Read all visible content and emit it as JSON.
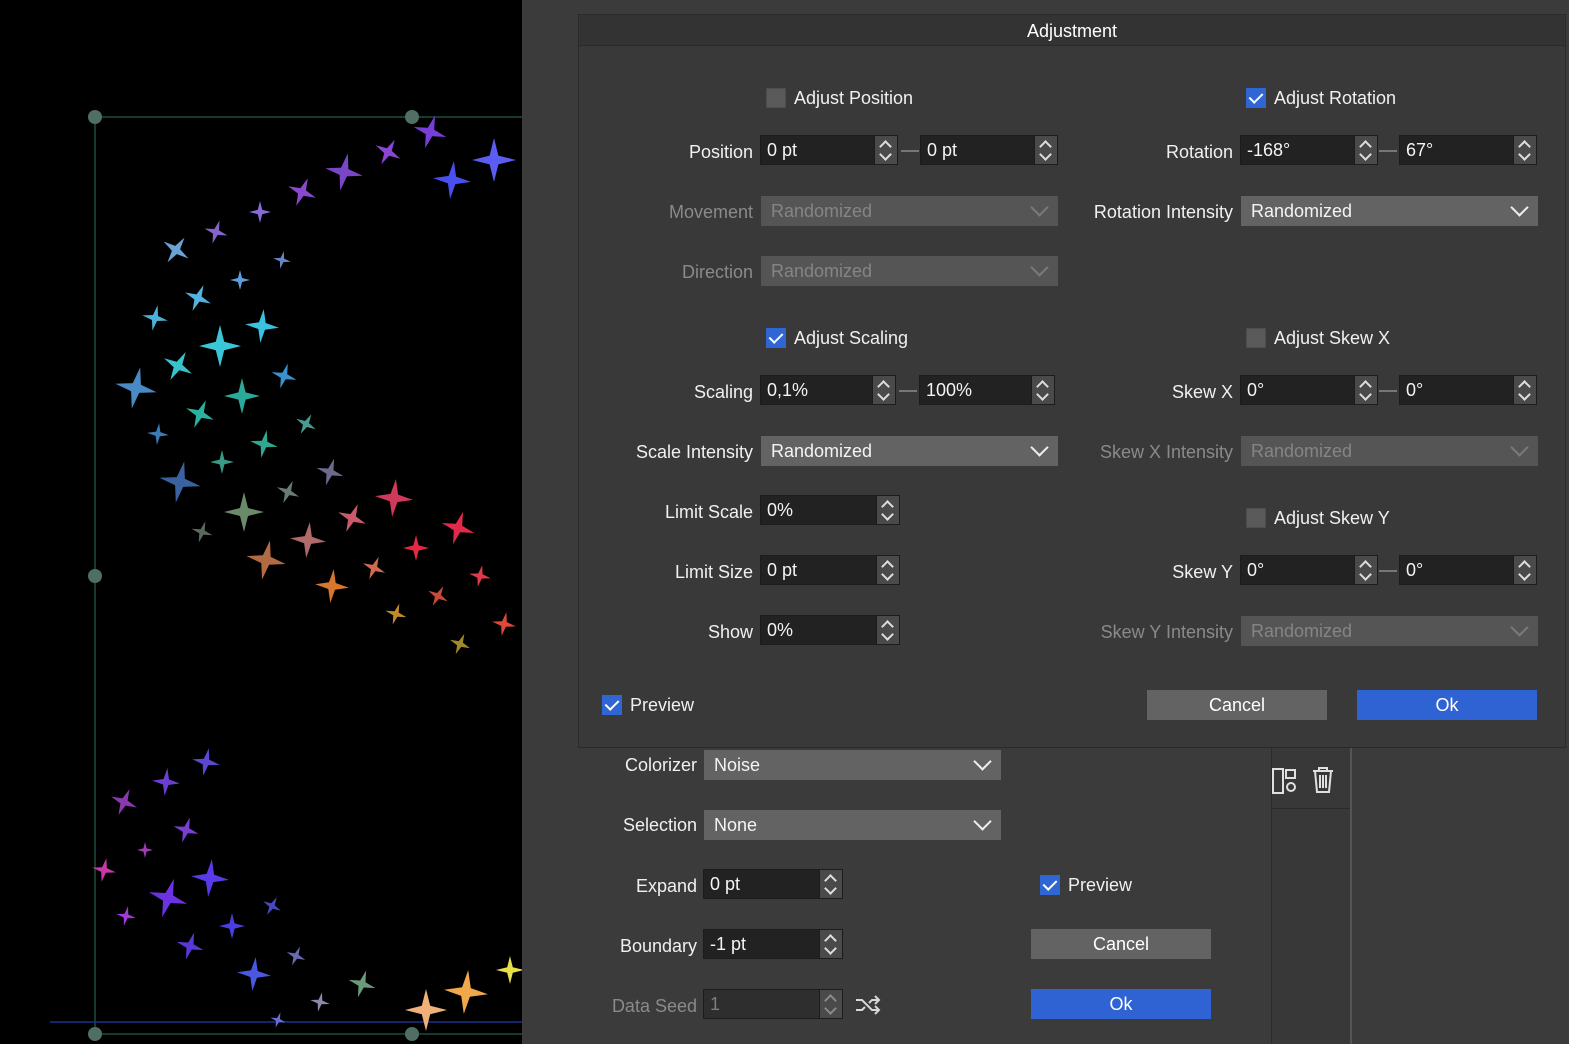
{
  "dialog": {
    "title": "Adjustment",
    "adjust_position": {
      "label": "Adjust Position",
      "checked": false
    },
    "adjust_rotation": {
      "label": "Adjust Rotation",
      "checked": true
    },
    "position": {
      "label": "Position",
      "from": "0 pt",
      "to": "0 pt"
    },
    "rotation": {
      "label": "Rotation",
      "from": "-168°",
      "to": "67°"
    },
    "movement": {
      "label": "Movement",
      "value": "Randomized"
    },
    "rotation_intensity": {
      "label": "Rotation Intensity",
      "value": "Randomized"
    },
    "direction": {
      "label": "Direction",
      "value": "Randomized"
    },
    "adjust_scaling": {
      "label": "Adjust Scaling",
      "checked": true
    },
    "adjust_skew_x": {
      "label": "Adjust Skew X",
      "checked": false
    },
    "scaling": {
      "label": "Scaling",
      "from": "0,1%",
      "to": "100%"
    },
    "skew_x": {
      "label": "Skew X",
      "from": "0°",
      "to": "0°"
    },
    "scale_intensity": {
      "label": "Scale Intensity",
      "value": "Randomized"
    },
    "skew_x_intensity": {
      "label": "Skew X Intensity",
      "value": "Randomized"
    },
    "limit_scale": {
      "label": "Limit Scale",
      "value": "0%"
    },
    "adjust_skew_y": {
      "label": "Adjust Skew Y",
      "checked": false
    },
    "limit_size": {
      "label": "Limit Size",
      "value": "0 pt"
    },
    "skew_y": {
      "label": "Skew Y",
      "from": "0°",
      "to": "0°"
    },
    "show": {
      "label": "Show",
      "value": "0%"
    },
    "skew_y_intensity": {
      "label": "Skew Y Intensity",
      "value": "Randomized"
    },
    "preview": {
      "label": "Preview",
      "checked": true
    },
    "cancel_label": "Cancel",
    "ok_label": "Ok"
  },
  "panel": {
    "colorizer": {
      "label": "Colorizer",
      "value": "Noise"
    },
    "selection": {
      "label": "Selection",
      "value": "None"
    },
    "expand": {
      "label": "Expand",
      "value": "0 pt"
    },
    "boundary": {
      "label": "Boundary",
      "value": "-1 pt"
    },
    "data_seed": {
      "label": "Data Seed",
      "value": "1"
    },
    "preview": {
      "label": "Preview",
      "checked": true
    },
    "cancel_label": "Cancel",
    "ok_label": "Ok"
  },
  "icons": {
    "shuffle": "shuffle-icon",
    "layout": "layout-panel-icon",
    "trash": "trash-icon"
  },
  "colors": {
    "accent": "#2f62d2",
    "canvas": "#000000",
    "panel": "#3b3b3b"
  }
}
